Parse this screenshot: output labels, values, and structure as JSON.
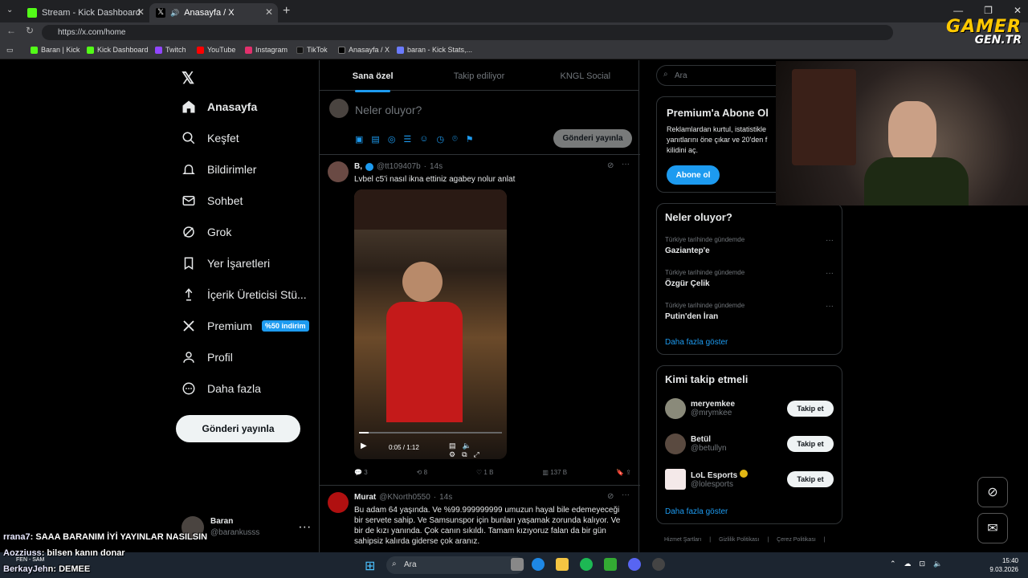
{
  "browser": {
    "tabs": [
      {
        "label": "Stream - Kick Dashboard"
      },
      {
        "label": "Anasayfa / X"
      }
    ],
    "url": "https://x.com/home",
    "bookmarks": [
      "Baran | Kick",
      "Kick Dashboard",
      "Twitch",
      "YouTube",
      "Instagram",
      "TikTok",
      "Anasayfa / X",
      "baran - Kick Stats,..."
    ]
  },
  "logo": {
    "line1": "GAMER",
    "line2": "GEN.TR"
  },
  "nav": {
    "items": [
      "Anasayfa",
      "Keşfet",
      "Bildirimler",
      "Sohbet",
      "Grok",
      "Yer İşaretleri",
      "İçerik Üreticisi Stü...",
      "Premium",
      "Profil",
      "Daha fazla"
    ],
    "premium_badge": "%50 indirim",
    "post_button": "Gönderi yayınla",
    "profile": {
      "name": "Baran",
      "handle": "@barankusss"
    }
  },
  "feed": {
    "tabs": [
      "Sana özel",
      "Takip ediliyor",
      "KNGL Social"
    ],
    "composer_placeholder": "Neler oluyor?",
    "publish_button": "Gönderi yayınla",
    "tweets": [
      {
        "name": "B,",
        "handle": "@tt109407b",
        "time": "14s",
        "text": "Lvbel c5'i nasıl ikna ettiniz agabey nolur anlat",
        "video_time": "0:05 / 1:12",
        "replies": "3",
        "retweets": "8",
        "likes": "1 B",
        "views": "137 B"
      },
      {
        "name": "Murat",
        "handle": "@KNorth0550",
        "time": "14s",
        "text": "Bu adam 64 yaşında. Ve %99.999999999 umuzun hayal bile edemeyeceği bir servete sahip. Ve Samsunspor için bunları yaşamak zorunda kalıyor. Ve bir de kızı yanında. Çok canın sıkıldı. Tamam kızıyoruz falan da bir gün sahipsiz kalırda giderse çok aranız."
      }
    ]
  },
  "sidebar": {
    "search_placeholder": "Ara",
    "premium": {
      "title": "Premium'a Abone Ol",
      "text": "Reklamlardan kurtul, istatistikle yanıtlarını öne çıkar ve 20'den f kilidini aç.",
      "button": "Abone ol"
    },
    "trends": {
      "title": "Neler oluyor?",
      "items": [
        {
          "context": "Türkiye tarihinde gündemde",
          "name": "Gaziantep'e"
        },
        {
          "context": "Türkiye tarihinde gündemde",
          "name": "Özgür Çelik"
        },
        {
          "context": "Türkiye tarihinde gündemde",
          "name": "Putin'den İran"
        }
      ],
      "more": "Daha fazla göster"
    },
    "who_to_follow": {
      "title": "Kimi takip etmeli",
      "items": [
        {
          "name": "meryemkee",
          "handle": "@mrymkee"
        },
        {
          "name": "Betül",
          "handle": "@betullyn"
        },
        {
          "name": "LoL Esports",
          "handle": "@lolesports"
        }
      ],
      "button": "Takip et",
      "more": "Daha fazla göster"
    },
    "footer": [
      "Hizmet Şartları",
      "Gizlilik Politikası",
      "Çerez Politikası"
    ]
  },
  "chat": [
    {
      "user": "rrana7",
      "msg": ": SAAA BARANIM İYİ YAYINLAR NASILSIN"
    },
    {
      "user": "Aozziuss",
      "msg": ": bilsen kanın donar"
    },
    {
      "user": "BerkayJeh",
      "msg": "n: DEMEE"
    }
  ],
  "taskbar": {
    "search": "Ara",
    "weather": "FEN - SAM",
    "time": "15:40",
    "date": "9.03.2026"
  },
  "colors": {
    "accent": "#1d9bf0",
    "kick": "#53fc18",
    "logo": "#ffc800"
  }
}
